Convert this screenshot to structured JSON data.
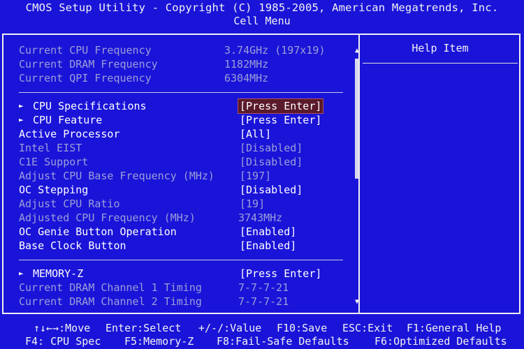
{
  "header": {
    "title": "CMOS Setup Utility - Copyright (C) 1985-2005, American Megatrends, Inc.",
    "menu": "Cell Menu"
  },
  "info": [
    {
      "label": "Current CPU Frequency",
      "value": "3.74GHz (197x19)"
    },
    {
      "label": "Current DRAM Frequency",
      "value": "1182MHz"
    },
    {
      "label": "Current QPI Frequency",
      "value": "6304MHz"
    }
  ],
  "settings": [
    {
      "label": "CPU Specifications",
      "value": "[Press Enter]",
      "submenu": true,
      "state": "selected"
    },
    {
      "label": "CPU Feature",
      "value": "[Press Enter]",
      "submenu": true,
      "state": "active"
    },
    {
      "label": "Active Processor",
      "value": "[All]",
      "submenu": false,
      "state": "active"
    },
    {
      "label": "Intel EIST",
      "value": "[Disabled]",
      "submenu": false,
      "state": "gray"
    },
    {
      "label": "C1E Support",
      "value": "[Disabled]",
      "submenu": false,
      "state": "gray"
    },
    {
      "label": "Adjust CPU Base Frequency (MHz)",
      "value": "[197]",
      "submenu": false,
      "state": "gray"
    },
    {
      "label": "OC Stepping",
      "value": "[Disabled]",
      "submenu": false,
      "state": "active"
    },
    {
      "label": "Adjust CPU Ratio",
      "value": "[19]",
      "submenu": false,
      "state": "gray"
    },
    {
      "label": "Adjusted CPU Frequency (MHz)",
      "value": "3743MHz",
      "submenu": false,
      "state": "gray"
    },
    {
      "label": "OC Genie Button Operation",
      "value": "[Enabled]",
      "submenu": false,
      "state": "active"
    },
    {
      "label": "Base Clock Button",
      "value": "[Enabled]",
      "submenu": false,
      "state": "active"
    }
  ],
  "memory": [
    {
      "label": "MEMORY-Z",
      "value": "[Press Enter]",
      "submenu": true,
      "state": "active"
    },
    {
      "label": "Current DRAM Channel 1 Timing",
      "value": "7-7-7-21",
      "submenu": false,
      "state": "gray"
    },
    {
      "label": "Current DRAM Channel 2 Timing",
      "value": "7-7-7-21",
      "submenu": false,
      "state": "gray"
    }
  ],
  "help": {
    "title": "Help Item"
  },
  "scroll": {
    "up_glyph": "▲",
    "down_glyph": "▼",
    "up_icon": "scroll-up-arrow-icon",
    "down_icon": "scroll-down-arrow-icon"
  },
  "submenu_arrow": "►",
  "footer": {
    "line1": [
      {
        "key": "↑↓←→:Move"
      },
      {
        "key": "Enter:Select"
      },
      {
        "key": "+/-/:Value"
      },
      {
        "key": "F10:Save"
      },
      {
        "key": "ESC:Exit"
      },
      {
        "key": "F1:General Help"
      }
    ],
    "line2": [
      {
        "key": "F4: CPU Spec"
      },
      {
        "key": "F5:Memory-Z"
      },
      {
        "key": "F8:Fail-Safe Defaults"
      },
      {
        "key": "F6:Optimized Defaults"
      }
    ]
  },
  "colors": {
    "background": "#1a14d8",
    "inactive_text": "#9b9fd8",
    "active_text": "#ffffff",
    "selection": "#5a1a2a"
  }
}
